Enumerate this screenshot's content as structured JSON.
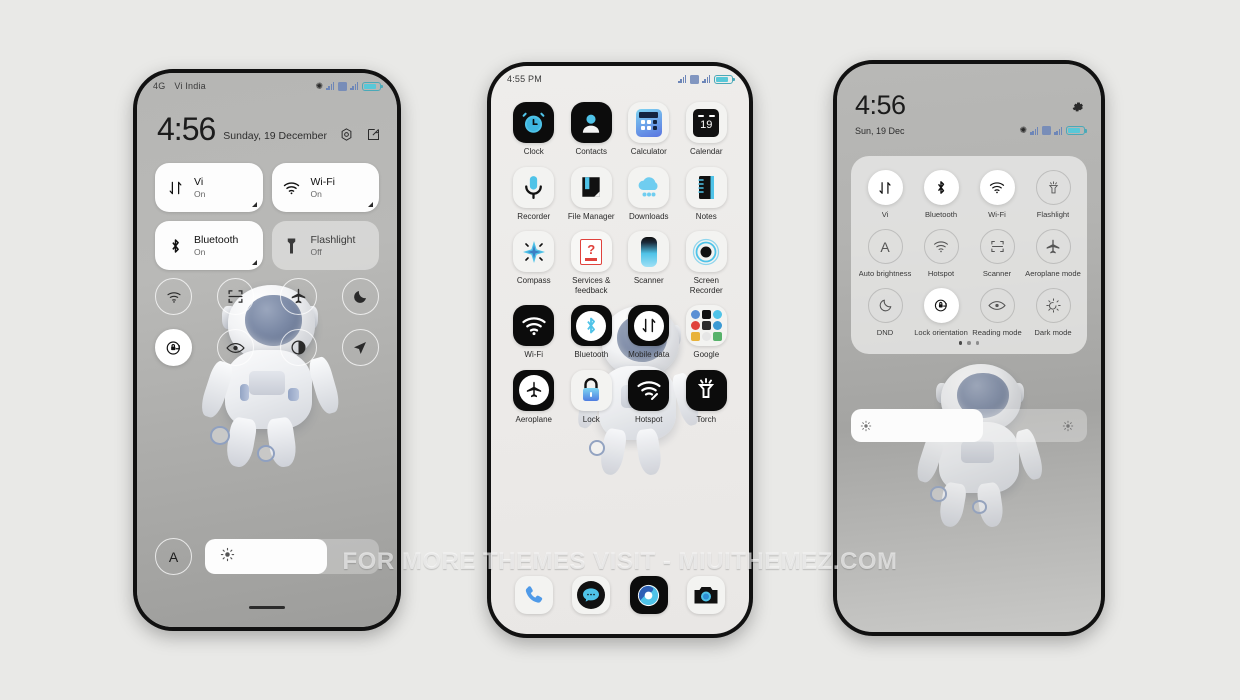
{
  "watermark": "FOR MORE THEMES VISIT - MIUITHEMEZ.COM",
  "colors": {
    "accent": "#4fc3e8",
    "page_bg": "#e9e9e7",
    "tile_on": "#fdfdfd",
    "battery": "#58c8d8"
  },
  "phone1": {
    "statusbar": {
      "network": "4G",
      "carrier": "Vi India",
      "bluetooth_icon": "bluetooth-icon",
      "battery_icon": "battery-icon"
    },
    "clock": "4:56",
    "date": "Sunday, 19 December",
    "header_icons": [
      {
        "name": "settings-gear-icon"
      },
      {
        "name": "edit-icon"
      }
    ],
    "big_tiles": [
      {
        "label": "Vi",
        "state": "On",
        "icon": "mobile-data-icon",
        "enabled": true
      },
      {
        "label": "Wi-Fi",
        "state": "On",
        "icon": "wifi-icon",
        "enabled": true
      },
      {
        "label": "Bluetooth",
        "state": "On",
        "icon": "bluetooth-icon",
        "enabled": true
      },
      {
        "label": "Flashlight",
        "state": "Off",
        "icon": "flashlight-icon",
        "enabled": false
      }
    ],
    "small_tiles_row1": [
      {
        "icon": "hotspot-icon",
        "enabled": false
      },
      {
        "icon": "scanner-icon",
        "enabled": false
      },
      {
        "icon": "aeroplane-icon",
        "enabled": false
      },
      {
        "icon": "dnd-moon-icon",
        "enabled": false
      }
    ],
    "small_tiles_row2": [
      {
        "icon": "lock-orientation-icon",
        "enabled": true
      },
      {
        "icon": "reading-mode-eye-icon",
        "enabled": false
      },
      {
        "icon": "dark-mode-contrast-icon",
        "enabled": false
      },
      {
        "icon": "location-arrow-icon",
        "enabled": false
      }
    ],
    "auto_brightness_label": "A",
    "brightness_icon": "brightness-sun-icon",
    "brightness_percent": 70
  },
  "phone2": {
    "statusbar": {
      "time": "4:55 PM"
    },
    "apps": [
      {
        "label": "Clock",
        "icon": "clock-app-icon"
      },
      {
        "label": "Contacts",
        "icon": "contacts-app-icon"
      },
      {
        "label": "Calculator",
        "icon": "calculator-app-icon"
      },
      {
        "label": "Calendar",
        "icon": "calendar-app-icon",
        "badge": "19"
      },
      {
        "label": "Recorder",
        "icon": "recorder-app-icon"
      },
      {
        "label": "File Manager",
        "icon": "file-manager-app-icon"
      },
      {
        "label": "Downloads",
        "icon": "downloads-app-icon"
      },
      {
        "label": "Notes",
        "icon": "notes-app-icon"
      },
      {
        "label": "Compass",
        "icon": "compass-app-icon"
      },
      {
        "label": "Services & feedback",
        "icon": "services-feedback-app-icon"
      },
      {
        "label": "Scanner",
        "icon": "scanner-app-icon"
      },
      {
        "label": "Screen Recorder",
        "icon": "screen-recorder-app-icon"
      },
      {
        "label": "Wi-Fi",
        "icon": "wifi-app-icon"
      },
      {
        "label": "Bluetooth",
        "icon": "bluetooth-app-icon"
      },
      {
        "label": "Mobile data",
        "icon": "mobile-data-app-icon"
      },
      {
        "label": "Google",
        "icon": "google-folder-icon"
      },
      {
        "label": "Aeroplane",
        "icon": "aeroplane-app-icon"
      },
      {
        "label": "Lock",
        "icon": "lock-app-icon"
      },
      {
        "label": "Hotspot",
        "icon": "hotspot-app-icon"
      },
      {
        "label": "Torch",
        "icon": "torch-app-icon"
      }
    ],
    "dock": [
      {
        "label": "Phone",
        "icon": "phone-dock-icon"
      },
      {
        "label": "Messages",
        "icon": "messages-dock-icon"
      },
      {
        "label": "Browser",
        "icon": "browser-dock-icon"
      },
      {
        "label": "Camera",
        "icon": "camera-dock-icon"
      }
    ]
  },
  "phone3": {
    "clock": "4:56",
    "date": "Sun, 19 Dec",
    "gear_icon": "settings-gear-icon",
    "row1": [
      {
        "label": "Vi",
        "icon": "mobile-data-icon",
        "enabled": true,
        "arrow": true
      },
      {
        "label": "Bluetooth",
        "icon": "bluetooth-icon",
        "enabled": true,
        "arrow": true
      },
      {
        "label": "Wi-Fi",
        "icon": "wifi-icon",
        "enabled": true,
        "arrow": true
      },
      {
        "label": "Flashlight",
        "icon": "flashlight-icon",
        "enabled": false,
        "arrow": false
      }
    ],
    "row2": [
      {
        "label": "Auto brightness",
        "icon": "auto-brightness-icon",
        "enabled": false
      },
      {
        "label": "Hotspot",
        "icon": "hotspot-icon",
        "enabled": false
      },
      {
        "label": "Scanner",
        "icon": "scanner-icon",
        "enabled": false
      },
      {
        "label": "Aeroplane mode",
        "icon": "aeroplane-icon",
        "enabled": false
      }
    ],
    "row3": [
      {
        "label": "DND",
        "icon": "dnd-moon-icon",
        "enabled": false
      },
      {
        "label": "Lock orientation",
        "icon": "lock-orientation-icon",
        "enabled": true
      },
      {
        "label": "Reading mode",
        "icon": "reading-mode-eye-icon",
        "enabled": false
      },
      {
        "label": "Dark mode",
        "icon": "dark-mode-icon",
        "enabled": false
      }
    ],
    "page_dots": 3,
    "active_dot": 0,
    "brightness_percent": 56,
    "brightness_icon_left": "brightness-low-icon",
    "brightness_icon_right": "brightness-high-icon"
  }
}
